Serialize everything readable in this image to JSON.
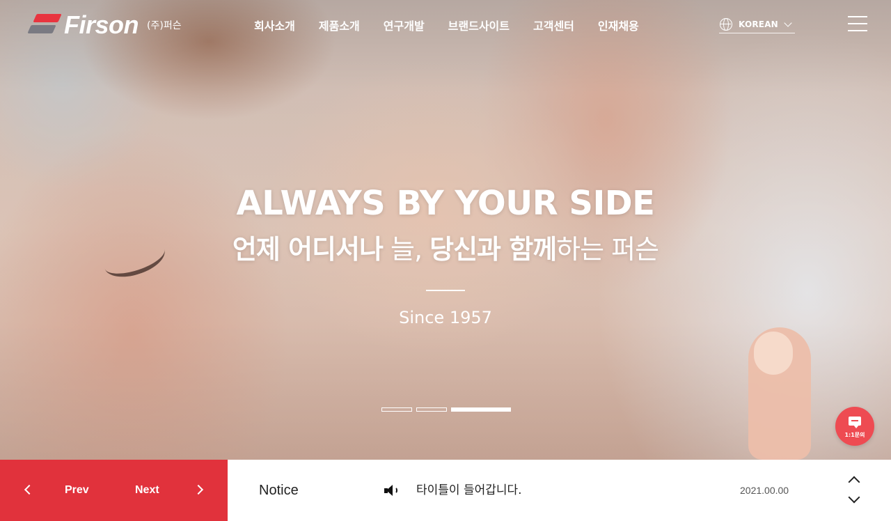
{
  "header": {
    "logo_text": "Firson",
    "logo_sub": "(주)퍼슨",
    "nav": [
      "회사소개",
      "제품소개",
      "연구개발",
      "브랜드사이트",
      "고객센터",
      "인재채용"
    ],
    "language": "KOREAN"
  },
  "hero": {
    "title": "ALWAYS BY YOUR SIDE",
    "subtitle": {
      "part1": "언제 어디서나",
      "part2": " 늘, ",
      "part3": "당신과 함께",
      "part4": "하는 퍼슨"
    },
    "since": "Since 1957",
    "active_slide": 3,
    "slide_count": 3
  },
  "inquiry": {
    "label": "1:1문의"
  },
  "bottom": {
    "prev_label": "Prev",
    "next_label": "Next",
    "notice_label": "Notice",
    "notice_title": "타이틀이 들어갑니다.",
    "notice_date": "2021.00.00"
  },
  "colors": {
    "accent": "#e1323c",
    "inquiry_button": "#ee4b52",
    "logo_gray": "#7a7a82"
  },
  "icons": {
    "logo": "firson-logo-icon",
    "language": "globe-icon",
    "language_toggle": "chevron-down-icon",
    "menu": "hamburger-menu-icon",
    "inquiry": "chat-bubble-icon",
    "prev": "chevron-left-icon",
    "next": "chevron-right-icon",
    "notice_more": "plus-circle-icon",
    "notice": "speaker-icon",
    "notice_up": "chevron-up-icon",
    "notice_down": "chevron-down-icon"
  }
}
